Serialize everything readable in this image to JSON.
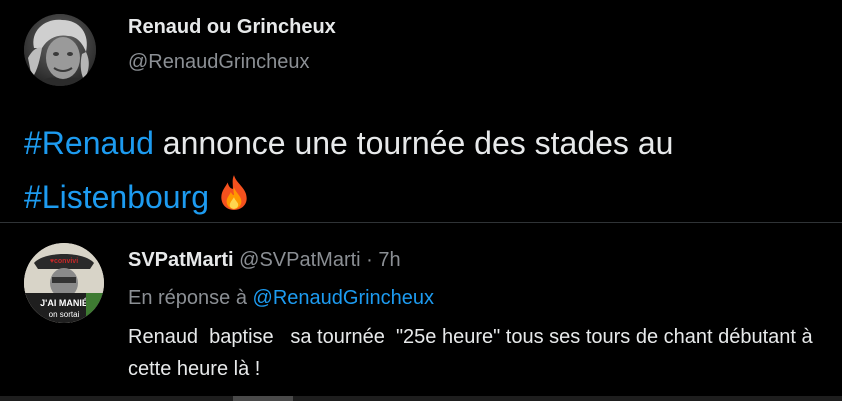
{
  "main_tweet": {
    "author_name": "Renaud ou Grincheux",
    "author_handle": "@RenaudGrincheux",
    "hashtag1": "#Renaud",
    "text_middle": " annonce une tournée des stades au ",
    "hashtag2": "#Listenbourg",
    "emoji_icon": "fire-icon"
  },
  "reply_tweet": {
    "author_name": "SVPatMarti",
    "author_handle": "@SVPatMarti",
    "separator": " · ",
    "time": "7h",
    "reply_prefix": "En réponse à ",
    "reply_mention": "@RenaudGrincheux",
    "text": "Renaud  baptise   sa tournée  \"25e heure\" tous ses tours de chant débutant à  cette heure là !",
    "avatar_text_1": "J'AI MANIÉ",
    "avatar_text_2": "on sortai"
  },
  "colors": {
    "background": "#000000",
    "text": "#e7e9ea",
    "muted": "#8b8f94",
    "link": "#1d9bf0",
    "divider": "#2f3336"
  }
}
